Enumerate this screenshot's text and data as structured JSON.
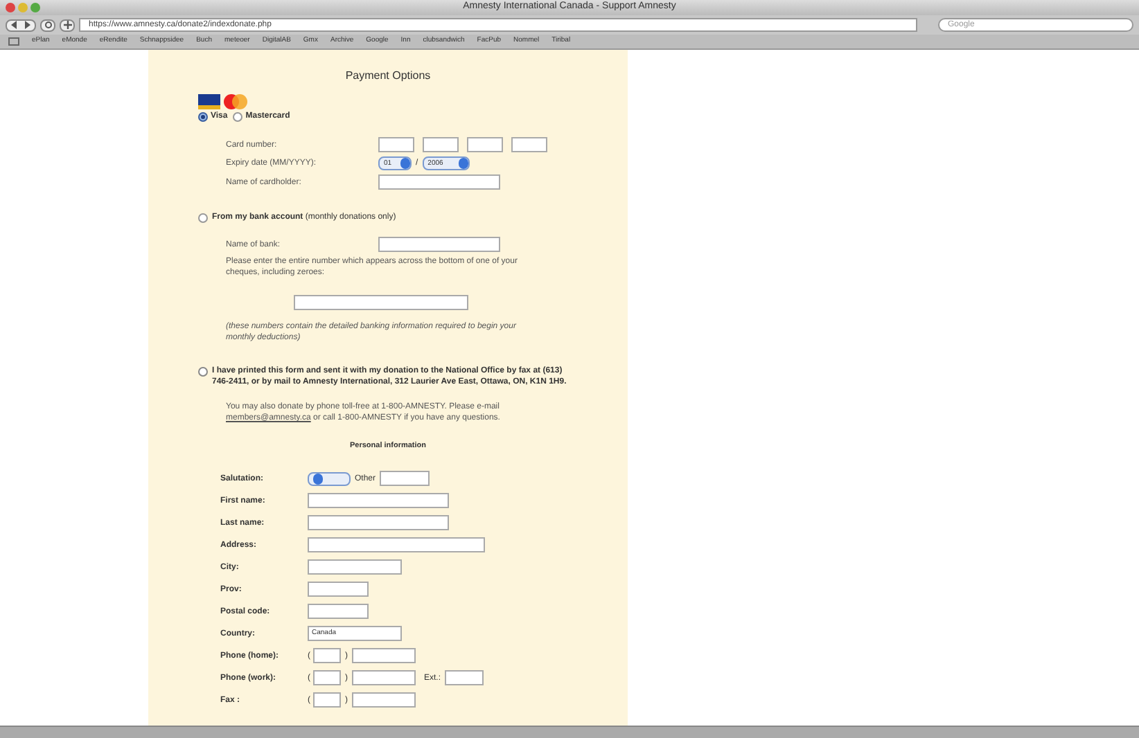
{
  "window": {
    "title": "Amnesty International Canada - Support Amnesty"
  },
  "toolbar": {
    "url": "https://www.amnesty.ca/donate2/indexdonate.php",
    "search_placeholder": "Google"
  },
  "bookmarks": [
    "ePlan",
    "eMonde",
    "eRendite",
    "Schnappsidee",
    "Buch",
    "meteoer",
    "DigitalAB",
    "Gmx",
    "Archive",
    "Google",
    "Inn",
    "clubsandwich",
    "FacPub",
    "Nommel",
    "Tiribal"
  ],
  "payment": {
    "heading": "Payment Options",
    "card_types": [
      {
        "label": "Visa",
        "selected": true
      },
      {
        "label": "Mastercard",
        "selected": false
      }
    ],
    "card_number_label": "Card number:",
    "expiry_label": "Expiry date (MM/YYYY):",
    "expiry_month": "01",
    "expiry_separator": "/",
    "expiry_year": "2006",
    "cardholder_label": "Name of cardholder:",
    "bank_option": {
      "selected": false,
      "text": "**From my bank account** (monthly donations only)"
    },
    "bank_name_label": "Name of bank:",
    "bank_instructions": "Please enter the entire number which appears across the bottom of one of your cheques, including zeroes:",
    "bank_note": "(these numbers contain the detailed banking information required to begin your monthly deductions)",
    "mail_option": {
      "checked": false,
      "text": "I have printed this form and sent it with my donation to the National Office by fax at (613) 746-2411, or by mail to Amnesty International, 312 Laurier Ave East, Ottawa, ON, K1N 1H9."
    },
    "phone_note": "You may also donate by phone toll-free at 1-800-AMNESTY. Please e-mail",
    "phone_note_link": "members@amnesty.ca",
    "phone_note_end": "or call 1-800-AMNESTY if you have any questions."
  },
  "personal": {
    "heading": "Personal information",
    "fields": [
      {
        "kind": "salutation",
        "label": "Salutation:",
        "other_label": "Other"
      },
      {
        "kind": "text",
        "label": "First name:"
      },
      {
        "kind": "text",
        "label": "Last name:"
      },
      {
        "kind": "text",
        "label": "Address:"
      },
      {
        "kind": "text",
        "label": "City:"
      },
      {
        "kind": "text",
        "label": "Prov:"
      },
      {
        "kind": "text",
        "label": "Postal code:"
      },
      {
        "kind": "text",
        "label": "Country:",
        "value": "Canada"
      },
      {
        "kind": "phone",
        "label": "Phone (home):",
        "paren": "(",
        "close": ")"
      },
      {
        "kind": "phone",
        "label": "Phone (work):",
        "paren": "(",
        "close": ")",
        "ext_label": "Ext.:"
      },
      {
        "kind": "phone",
        "label": "Fax :",
        "paren": "(",
        "close": ")"
      }
    ]
  }
}
